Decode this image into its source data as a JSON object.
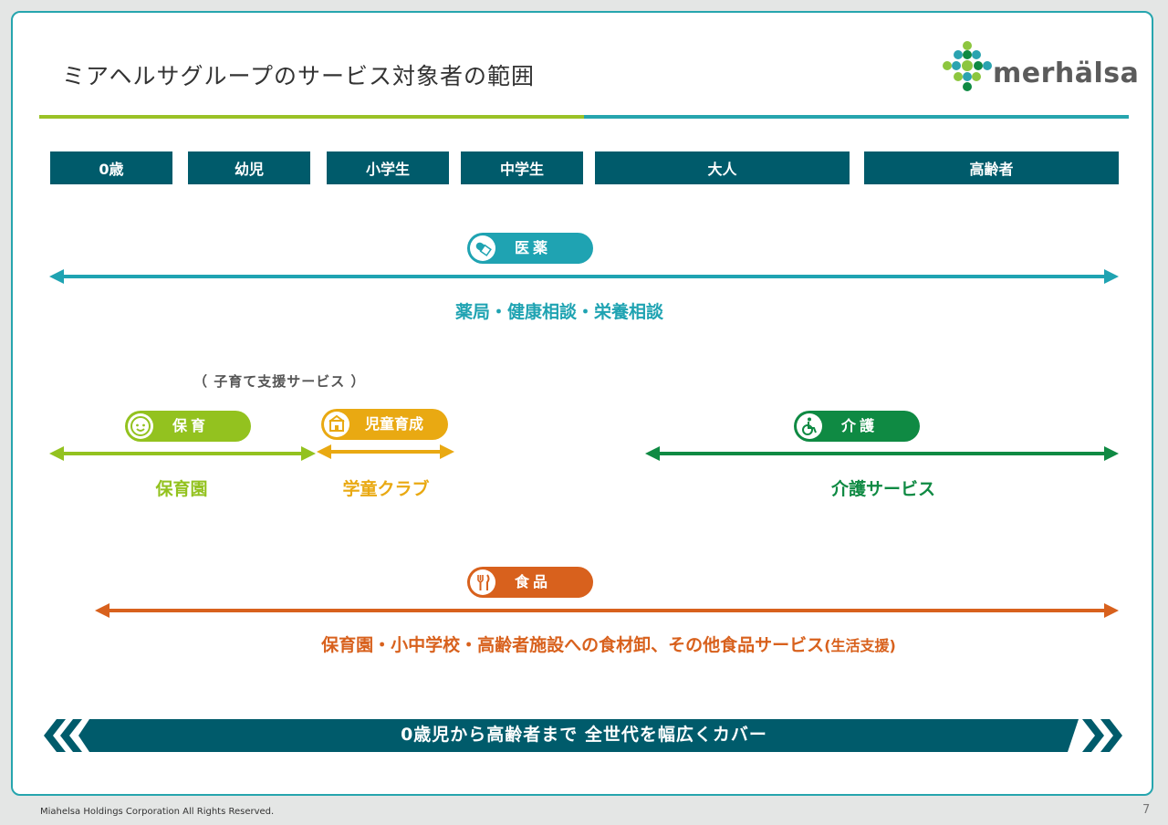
{
  "title": "ミアヘルサグループのサービス対象者の範囲",
  "logo": {
    "wordmark": "merhälsa"
  },
  "ages": [
    {
      "label": "0歳"
    },
    {
      "label": "幼児"
    },
    {
      "label": "小学生"
    },
    {
      "label": "中学生"
    },
    {
      "label": "大人"
    },
    {
      "label": "高齢者"
    }
  ],
  "services": {
    "medical": {
      "pill": "医薬",
      "icon": "pill-capsule-icon",
      "color": "#1fa3b2",
      "range_label": "薬局・健康相談・栄養相談"
    },
    "childcare_note": "（ 子育て支援サービス ）",
    "nursery": {
      "pill": "保育",
      "icon": "baby-face-icon",
      "color": "#93c21f",
      "range_label": "保育園"
    },
    "after_school": {
      "pill": "児童育成",
      "icon": "school-building-icon",
      "color": "#e9a912",
      "range_label": "学童クラブ"
    },
    "care": {
      "pill": "介護",
      "icon": "wheelchair-icon",
      "color": "#0f8a43",
      "range_label": "介護サービス"
    },
    "food": {
      "pill": "食品",
      "icon": "fork-knife-icon",
      "color": "#d8611d",
      "range_label": "保育園・小中学校・高齢者施設への食材卸、その他食品サービス",
      "range_suffix": "(生活支援)"
    }
  },
  "banner": {
    "text": "0歳児から高齢者まで 全世代を幅広くカバー",
    "color": "#005b6b"
  },
  "footer": {
    "copyright": "Miahelsa Holdings Corporation All Rights Reserved.",
    "page": "7"
  }
}
